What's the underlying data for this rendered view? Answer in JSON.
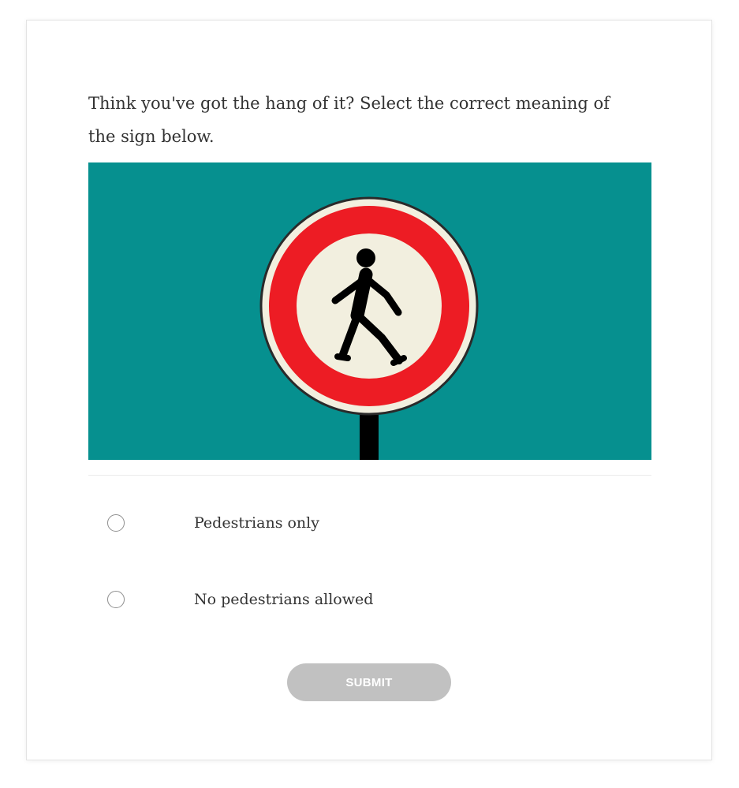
{
  "question": {
    "text": "Think you've got the hang of it? Select the correct meaning of the sign below."
  },
  "sign_image": {
    "icon": "no-pedestrians-sign",
    "background_color": "#06908f",
    "ring_color": "#ed1c24",
    "inner_color": "#f2efdf",
    "figure_color": "#000000"
  },
  "options": [
    {
      "label": "Pedestrians only",
      "selected": false
    },
    {
      "label": "No pedestrians allowed",
      "selected": false
    }
  ],
  "submit": {
    "label": "SUBMIT",
    "state": "disabled",
    "color": "#c1c1c1"
  }
}
